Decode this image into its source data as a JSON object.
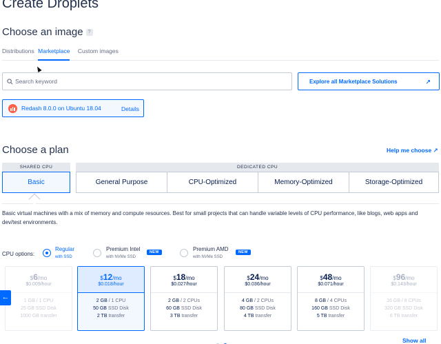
{
  "page": {
    "title": "Create Droplets"
  },
  "image_section": {
    "heading": "Choose an image",
    "help_glyph": "?",
    "tabs": [
      {
        "label": "Distributions"
      },
      {
        "label": "Marketplace"
      },
      {
        "label": "Custom images"
      }
    ],
    "active_tab": "Marketplace",
    "search_placeholder": "Search keyword",
    "search_value": "",
    "explore_label": "Explore all Marketplace Solutions",
    "selected_image": {
      "label": "Redash 8.0.0 on Ubuntu 18.04",
      "details_label": "Details"
    }
  },
  "plan_section": {
    "heading": "Choose a plan",
    "help_link": "Help me choose",
    "shared_header": "SHARED CPU",
    "dedicated_header": "DEDICATED CPU",
    "plans": [
      "Basic",
      "General Purpose",
      "CPU-Optimized",
      "Memory-Optimized",
      "Storage-Optimized"
    ],
    "active_plan": "Basic",
    "description": "Basic virtual machines with a mix of memory and compute resources. Best for small projects that can handle variable levels of CPU performance, like blogs, web apps and dev/test environments.",
    "cpu_options_label": "CPU options:",
    "cpu_options": [
      {
        "main": "Regular",
        "sub": "with SSD",
        "selected": true,
        "badge": ""
      },
      {
        "main": "Premium Intel",
        "sub": "with NVMe SSD",
        "selected": false,
        "badge": "NEW"
      },
      {
        "main": "Premium AMD",
        "sub": "with NVMe SSD",
        "selected": false,
        "badge": "NEW"
      }
    ],
    "cards": [
      {
        "dollar": "$",
        "amount": "6",
        "unit": "/mo",
        "hourly": "$0.009/hour",
        "memory": "1 GB",
        "cpu": "/ 1 CPU",
        "disk": "25 GB",
        "disk_unit": "SSD Disk",
        "transfer": "1000 GB",
        "transfer_unit": "transfer",
        "state": "faded"
      },
      {
        "dollar": "$",
        "amount": "12",
        "unit": "/mo",
        "hourly": "$0.018/hour",
        "memory": "2 GB",
        "cpu": "/ 1 CPU",
        "disk": "50 GB",
        "disk_unit": "SSD Disk",
        "transfer": "2 TB",
        "transfer_unit": "transfer",
        "state": "selected"
      },
      {
        "dollar": "$",
        "amount": "18",
        "unit": "/mo",
        "hourly": "$0.027/hour",
        "memory": "2 GB",
        "cpu": "/ 2 CPUs",
        "disk": "60 GB",
        "disk_unit": "SSD Disk",
        "transfer": "3 TB",
        "transfer_unit": "transfer",
        "state": "normal"
      },
      {
        "dollar": "$",
        "amount": "24",
        "unit": "/mo",
        "hourly": "$0.036/hour",
        "memory": "4 GB",
        "cpu": "/ 2 CPUs",
        "disk": "80 GB",
        "disk_unit": "SSD Disk",
        "transfer": "4 TB",
        "transfer_unit": "transfer",
        "state": "normal"
      },
      {
        "dollar": "$",
        "amount": "48",
        "unit": "/mo",
        "hourly": "$0.071/hour",
        "memory": "8 GB",
        "cpu": "/ 4 CPUs",
        "disk": "160 GB",
        "disk_unit": "SSD Disk",
        "transfer": "5 TB",
        "transfer_unit": "transfer",
        "state": "normal"
      },
      {
        "dollar": "$",
        "amount": "96",
        "unit": "/mo",
        "hourly": "$0.143/hour",
        "memory": "16 GB",
        "cpu": "/ 8 CPUs",
        "disk": "320 GB",
        "disk_unit": "SSD Disk",
        "transfer": "6 TB",
        "transfer_unit": "transfer",
        "state": "faded"
      }
    ],
    "show_all_label": "Show all plans",
    "pager": {
      "pages": 2,
      "current": 2
    }
  },
  "colors": {
    "accent": "#0069ff",
    "text": "#031b4e",
    "border": "#c3cbd6",
    "logo": "#ff5f45"
  },
  "icons": [
    "search-icon",
    "external-arrow-icon",
    "redash-logo-icon",
    "help-external-icon",
    "arrow-left-icon",
    "mouse-cursor-icon"
  ]
}
